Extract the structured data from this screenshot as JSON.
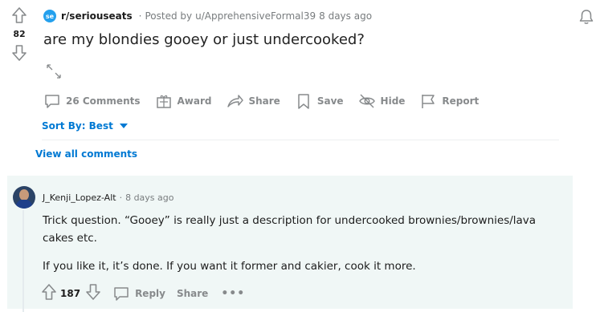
{
  "post": {
    "subreddit": "r/seriouseats",
    "subreddit_icon": "se",
    "posted_by_prefix": "Posted by",
    "author": "u/ApprehensiveFormal39",
    "time": "8 days ago",
    "vote_count": "82",
    "title": "are my blondies gooey or just undercooked?",
    "actions": {
      "comments": "26 Comments",
      "award": "Award",
      "share": "Share",
      "save": "Save",
      "hide": "Hide",
      "report": "Report"
    }
  },
  "sort": {
    "label": "Sort By: Best"
  },
  "view_all": "View all comments",
  "comment": {
    "author": "J_Kenji_Lopez-Alt",
    "separator": "·",
    "time": "8 days ago",
    "paragraphs": [
      "Trick question. “Gooey” is really just a description for undercooked brownies/brownies/lava cakes etc.",
      "If you like it, it’s done. If you want it former and cakier, cook it more."
    ],
    "score": "187",
    "reply": "Reply",
    "share": "Share",
    "more": "•••"
  },
  "colors": {
    "accent": "#0079d3",
    "comment_bg": "#f0f7f6",
    "muted": "#878a8c"
  }
}
